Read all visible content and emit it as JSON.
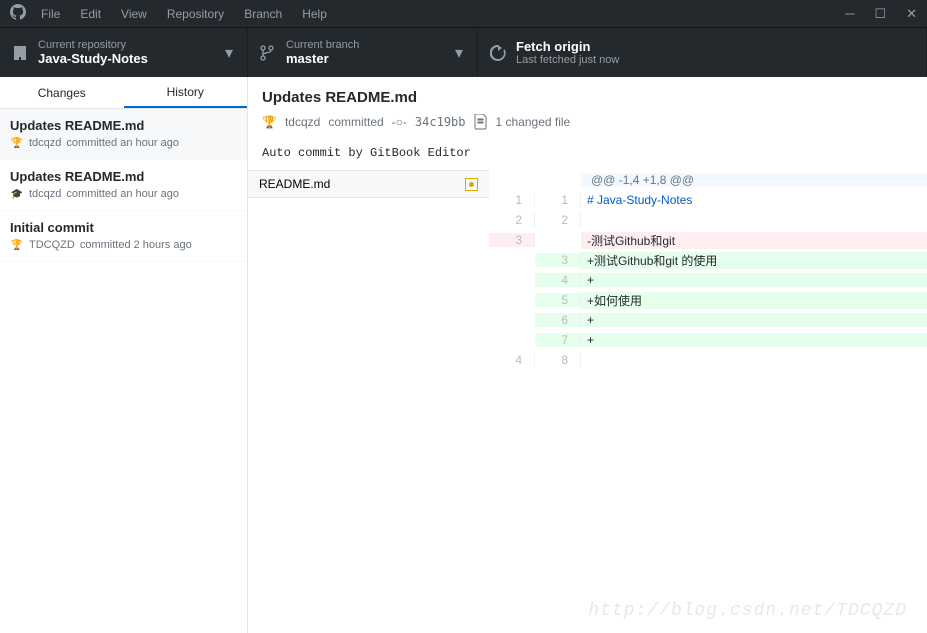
{
  "menu": {
    "file": "File",
    "edit": "Edit",
    "view": "View",
    "repository": "Repository",
    "branch": "Branch",
    "help": "Help"
  },
  "toolbar": {
    "repo_label": "Current repository",
    "repo_name": "Java-Study-Notes",
    "branch_label": "Current branch",
    "branch_name": "master",
    "fetch_label": "Fetch origin",
    "fetch_status": "Last fetched just now"
  },
  "tabs": {
    "changes": "Changes",
    "history": "History"
  },
  "commits": [
    {
      "title": "Updates README.md",
      "author": "tdcqzd",
      "time": "committed an hour ago",
      "avatar": "🏆"
    },
    {
      "title": "Updates README.md",
      "author": "tdcqzd",
      "time": "committed an hour ago",
      "avatar": "🎓"
    },
    {
      "title": "Initial commit",
      "author": "TDCQZD",
      "time": "committed 2 hours ago",
      "avatar": "🏆"
    }
  ],
  "detail": {
    "title": "Updates README.md",
    "author": "tdcqzd",
    "action": "committed",
    "sha": "34c19bb",
    "files_count": "1 changed file",
    "message": "Auto commit by GitBook Editor",
    "filename": "README.md"
  },
  "diff": {
    "hunk": "@@ -1,4 +1,8 @@",
    "lines": [
      {
        "old": "1",
        "new": "1",
        "type": "ctx",
        "text": " # Java-Study-Notes",
        "heading": true
      },
      {
        "old": "2",
        "new": "2",
        "type": "ctx",
        "text": ""
      },
      {
        "old": "3",
        "new": "",
        "type": "del",
        "text": "-测试Github和git"
      },
      {
        "old": "",
        "new": "3",
        "type": "add",
        "text": "+测试Github和git 的使用"
      },
      {
        "old": "",
        "new": "4",
        "type": "add",
        "text": "+"
      },
      {
        "old": "",
        "new": "5",
        "type": "add",
        "text": "+如何使用"
      },
      {
        "old": "",
        "new": "6",
        "type": "add",
        "text": "+"
      },
      {
        "old": "",
        "new": "7",
        "type": "add",
        "text": "+"
      },
      {
        "old": "4",
        "new": "8",
        "type": "ctx",
        "text": ""
      }
    ]
  },
  "watermark": "http://blog.csdn.net/TDCQZD"
}
